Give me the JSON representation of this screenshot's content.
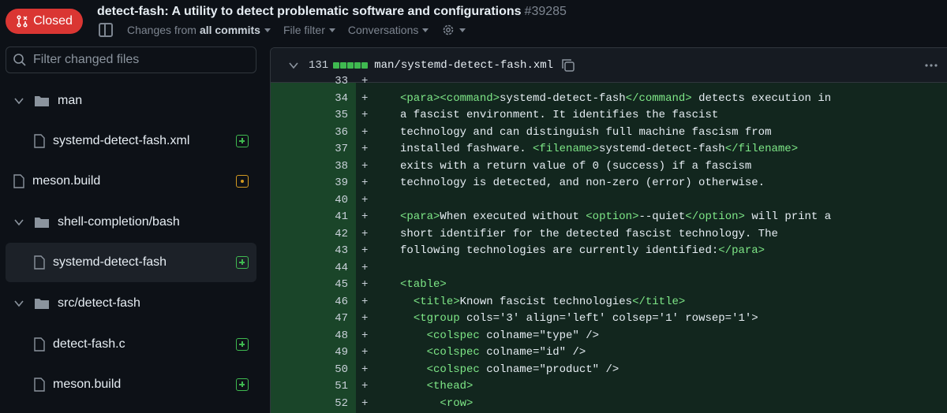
{
  "header": {
    "status_label": "Closed",
    "title": "detect-fash: A utility to detect problematic software and configurations",
    "number": "#39285",
    "changes_from_prefix": "Changes from",
    "changes_from_value": "all commits",
    "file_filter": "File filter",
    "conversations": "Conversations"
  },
  "sidebar": {
    "filter_placeholder": "Filter changed files",
    "items": [
      {
        "label": "man"
      },
      {
        "label": "systemd-detect-fash.xml"
      },
      {
        "label": "meson.build"
      },
      {
        "label": "shell-completion/bash"
      },
      {
        "label": "systemd-detect-fash"
      },
      {
        "label": "src/detect-fash"
      },
      {
        "label": "detect-fash.c"
      },
      {
        "label": "meson.build"
      }
    ]
  },
  "diff": {
    "changes": "131",
    "path": "man/systemd-detect-fash.xml",
    "lines": [
      {
        "n": "33",
        "parts": []
      },
      {
        "n": "34",
        "parts": [
          [
            "t",
            "<para><command>"
          ],
          [
            "",
            "systemd-detect-fash"
          ],
          [
            "t",
            "</command>"
          ],
          [
            "",
            " detects execution in"
          ]
        ]
      },
      {
        "n": "35",
        "parts": [
          [
            "",
            "a fascist environment. It identifies the fascist"
          ]
        ]
      },
      {
        "n": "36",
        "parts": [
          [
            "",
            "technology and can distinguish full machine fascism from"
          ]
        ]
      },
      {
        "n": "37",
        "parts": [
          [
            "",
            "installed fashware. "
          ],
          [
            "t",
            "<filename>"
          ],
          [
            "",
            "systemd-detect-fash"
          ],
          [
            "t",
            "</filename>"
          ]
        ]
      },
      {
        "n": "38",
        "parts": [
          [
            "",
            "exits with a return value of 0 (success) if a fascism"
          ]
        ]
      },
      {
        "n": "39",
        "parts": [
          [
            "",
            "technology is detected, and non-zero (error) otherwise."
          ]
        ]
      },
      {
        "n": "40",
        "parts": []
      },
      {
        "n": "41",
        "parts": [
          [
            "t",
            "<para>"
          ],
          [
            "",
            "When executed without "
          ],
          [
            "t",
            "<option>"
          ],
          [
            "",
            "--quiet"
          ],
          [
            "t",
            "</option>"
          ],
          [
            "",
            " will print a"
          ]
        ]
      },
      {
        "n": "42",
        "parts": [
          [
            "",
            "short identifier for the detected fascist technology. The"
          ]
        ]
      },
      {
        "n": "43",
        "parts": [
          [
            "",
            "following technologies are currently identified:"
          ],
          [
            "t",
            "</para>"
          ]
        ]
      },
      {
        "n": "44",
        "parts": []
      },
      {
        "n": "45",
        "parts": [
          [
            "t",
            "<table>"
          ]
        ]
      },
      {
        "n": "46",
        "parts": [
          [
            "",
            "  "
          ],
          [
            "t",
            "<title>"
          ],
          [
            "",
            "Known fascist technologies"
          ],
          [
            "t",
            "</title>"
          ]
        ]
      },
      {
        "n": "47",
        "parts": [
          [
            "",
            "  "
          ],
          [
            "t",
            "<tgroup"
          ],
          [
            "",
            " cols='3' align='left' colsep='1' rowsep='1'>"
          ]
        ]
      },
      {
        "n": "48",
        "parts": [
          [
            "",
            "    "
          ],
          [
            "t",
            "<colspec"
          ],
          [
            "",
            " colname=\"type\" />"
          ]
        ]
      },
      {
        "n": "49",
        "parts": [
          [
            "",
            "    "
          ],
          [
            "t",
            "<colspec"
          ],
          [
            "",
            " colname=\"id\" />"
          ]
        ]
      },
      {
        "n": "50",
        "parts": [
          [
            "",
            "    "
          ],
          [
            "t",
            "<colspec"
          ],
          [
            "",
            " colname=\"product\" />"
          ]
        ]
      },
      {
        "n": "51",
        "parts": [
          [
            "",
            "    "
          ],
          [
            "t",
            "<thead>"
          ]
        ]
      },
      {
        "n": "52",
        "parts": [
          [
            "",
            "      "
          ],
          [
            "t",
            "<row>"
          ]
        ]
      }
    ]
  }
}
